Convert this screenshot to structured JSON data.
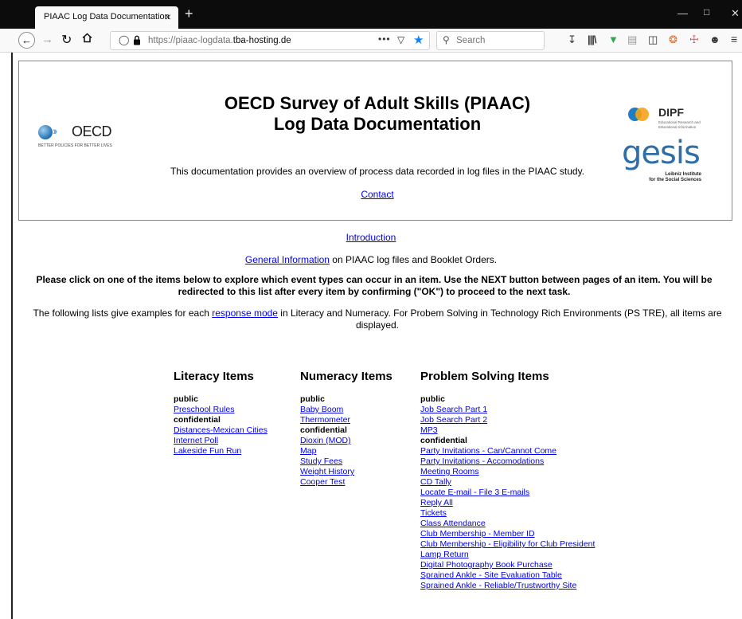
{
  "browser": {
    "tab_title": "PIAAC Log Data Documentation",
    "tab_close": "×",
    "new_tab": "+",
    "url_prefix": "https://piaac-logdata.",
    "url_domain": "tba-hosting.de",
    "search_placeholder": "Search",
    "icons": [
      "back-arrow-icon",
      "forward-arrow-icon",
      "reload-icon",
      "home-icon",
      "shield-icon",
      "lock-icon",
      "page-actions-icon",
      "pocket-icon",
      "bookmark-star-icon",
      "search-icon",
      "download-icon",
      "library-icon",
      "adblock-shield-icon",
      "reader-icon",
      "sidebar-icon",
      "extension-icon",
      "extension-icon-2",
      "account-icon",
      "menu-icon"
    ]
  },
  "header": {
    "title_line1": "OECD Survey of Adult Skills (PIAAC)",
    "title_line2": "Log Data Documentation",
    "description": "This documentation provides an overview of process data recorded in log files in the PIAAC study.",
    "contact_link": "Contact",
    "oecd_logo_text": "OECD",
    "oecd_tagline": "BETTER POLICIES FOR BETTER LIVES",
    "dipf_logo_text": "DIPF",
    "dipf_subtitle": "Educational Research and Educational Information",
    "gesis_logo_text": "gesis",
    "gesis_subtitle_1": "Leibniz Institute",
    "gesis_subtitle_2": "for the Social Sciences"
  },
  "intro": {
    "introduction_link": "Introduction",
    "general_info_link": "General Information",
    "general_info_rest": " on PIAAC log files and Booklet Orders.",
    "instructions": "Please click on one of the items below to explore which event types can occur in an item. Use the NEXT button between pages of an item. You will be redirected to this list after every item by confirming (\"OK\") to proceed to the next task.",
    "lists_note_before": "The following lists give examples for each ",
    "lists_note_link": "response mode",
    "lists_note_after": " in Literacy and Numeracy. For Probem Solving in Technology Rich Environments (PS TRE), all items are displayed."
  },
  "literacy": {
    "heading": "Literacy Items",
    "public_label": "public",
    "public_items": [
      "Preschool Rules"
    ],
    "confidential_label": "confidential",
    "confidential_items": [
      "Distances-Mexican Cities",
      "Internet Poll",
      "Lakeside Fun Run"
    ]
  },
  "numeracy": {
    "heading": "Numeracy Items",
    "public_label": "public",
    "public_items": [
      "Baby Boom",
      "Thermometer"
    ],
    "confidential_label": "confidential",
    "confidential_items": [
      "Dioxin (MOD)",
      "Map",
      "Study Fees",
      "Weight History",
      "Cooper Test"
    ]
  },
  "problem_solving": {
    "heading": "Problem Solving Items",
    "public_label": "public",
    "public_items": [
      "Job Search Part 1",
      "Job Search Part 2",
      "MP3"
    ],
    "confidential_label": "confidential",
    "confidential_items": [
      "Party Invitations - Can/Cannot Come",
      "Party Invitations - Accomodations",
      "Meeting Rooms",
      "CD Tally",
      "Locate E-mail - File 3 E-mails",
      "Reply All",
      "Tickets",
      "Class Attendance",
      "Club Membership - Member ID",
      "Club Membership - Eligibility for Club President",
      "Lamp Return",
      "Digital Photography Book Purchase",
      "Sprained Ankle - Site Evaluation Table",
      "Sprained Ankle - Reliable/Trustworthy Site"
    ]
  }
}
